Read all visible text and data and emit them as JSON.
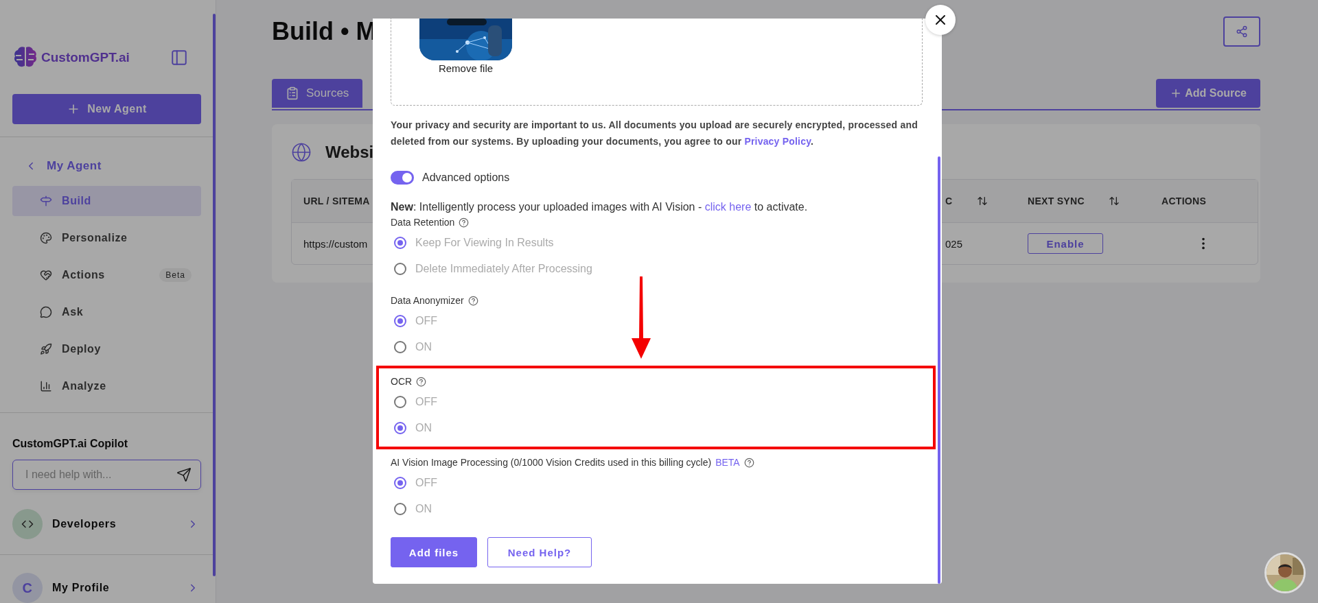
{
  "sidebar": {
    "logo": "CustomGPT.ai",
    "new_agent": "New Agent",
    "back": "My Agent",
    "items": [
      {
        "label": "Build",
        "selected": true
      },
      {
        "label": "Personalize",
        "selected": false
      },
      {
        "label": "Actions",
        "selected": false,
        "badge": "Beta"
      },
      {
        "label": "Ask",
        "selected": false
      },
      {
        "label": "Deploy",
        "selected": false
      },
      {
        "label": "Analyze",
        "selected": false
      }
    ],
    "copilot": {
      "title": "CustomGPT.ai Copilot",
      "placeholder": "I need help with..."
    },
    "developers": "Developers",
    "profile": {
      "initial": "C",
      "label": "My Profile"
    }
  },
  "main": {
    "title": "Build • M",
    "tabs": [
      {
        "label": "Sources",
        "selected": true
      }
    ],
    "add_source": "Add Source",
    "card": {
      "title": "Websi",
      "columns": [
        {
          "label": "URL / SITEMA"
        },
        {
          "label": "C",
          "sortable": true
        },
        {
          "label": "NEXT SYNC",
          "sortable": true
        },
        {
          "label": "ACTIONS",
          "sortable": false
        }
      ],
      "rows": [
        {
          "url": "https://custom",
          "last_sync": "025",
          "next_sync": "Enable"
        }
      ]
    }
  },
  "modal": {
    "remove_file": "Remove file",
    "privacy": "Your privacy and security are important to us. All documents you upload are securely encrypted, processed and deleted from our systems. By uploading your documents, you agree to our ",
    "privacy_link": "Privacy Policy",
    "privacy_end": ".",
    "advanced": {
      "label": "Advanced options",
      "on": true
    },
    "notice": {
      "text": "**New**: Intelligently process your uploaded images with AI Vision - ",
      "link": "click here",
      "end": " to activate."
    },
    "sections": [
      {
        "label": "Data Retention",
        "highlighted": false,
        "options": [
          {
            "label": "Keep For Viewing In Results",
            "selected": true
          },
          {
            "label": "Delete Immediately After Processing",
            "selected": false
          }
        ]
      },
      {
        "label": "Data Anonymizer",
        "highlighted": false,
        "options": [
          {
            "label": "OFF",
            "selected": true
          },
          {
            "label": "ON",
            "selected": false
          }
        ]
      },
      {
        "label": "OCR",
        "highlighted": true,
        "options": [
          {
            "label": "OFF",
            "selected": false
          },
          {
            "label": "ON",
            "selected": true
          }
        ]
      },
      {
        "label": "AI Vision Image Processing (0/1000 Vision Credits used in this billing cycle)",
        "tag": "BETA",
        "highlighted": false,
        "options": [
          {
            "label": "OFF",
            "selected": true
          },
          {
            "label": "ON",
            "selected": false
          }
        ]
      }
    ],
    "buttons": [
      {
        "label": "Add files",
        "kind": "primary"
      },
      {
        "label": "Need Help?",
        "kind": "outline"
      }
    ]
  }
}
